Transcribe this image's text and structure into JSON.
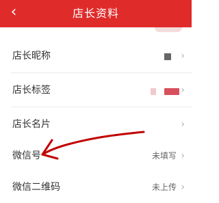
{
  "header": {
    "title": "店长资料",
    "back_icon": "‹"
  },
  "rows": [
    {
      "label": "店长昵称",
      "value": ""
    },
    {
      "label": "店长标签",
      "value": ""
    },
    {
      "label": "店长名片",
      "value": ""
    },
    {
      "label": "微信号",
      "value": "未填写"
    },
    {
      "label": "微信二维码",
      "value": "未上传"
    }
  ],
  "chevron": "›",
  "colors": {
    "header": "#e02b2b",
    "annotation": "#c00000"
  }
}
